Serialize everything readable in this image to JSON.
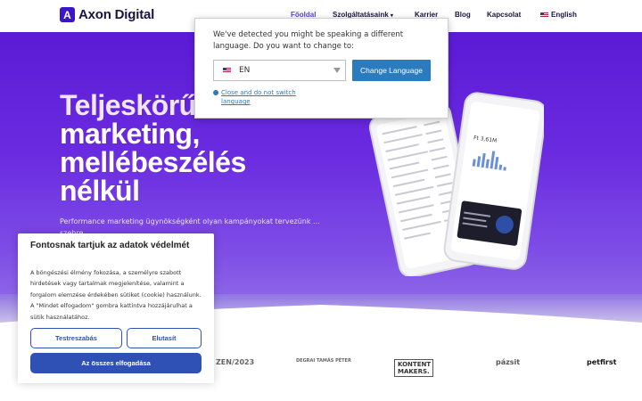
{
  "brand": {
    "name": "Axon Digital",
    "mark": "A"
  },
  "nav": {
    "items": [
      "Főoldal",
      "Szolgáltatásaink",
      "Karrier",
      "Blog",
      "Kapcsolat",
      "English"
    ]
  },
  "hero": {
    "headline": [
      "Teljeskörű",
      "marketing,",
      "mellébeszélés",
      "nélkül"
    ],
    "subtext": "Performance marketing ügynökségként olyan kampányokat tervezünk ... szebre."
  },
  "language_popup": {
    "message": "We've detected you might be speaking a different language. Do you want to change to:",
    "selected_language": "EN",
    "change_button": "Change Language",
    "close_link": "Close and do not switch language"
  },
  "cookie_banner": {
    "title": "Fontosnak tartjuk az adatok védelmét",
    "text": "A böngészési élmény fokozása, a személyre szabott hirdetések vagy tartalmak megjelenítése, valamint a forgalom elemzése érdekében sütiket (cookie) használunk. A \"Mindet elfogadom\" gombra kattintva hozzájárulhat a sütik használatához.",
    "customize_button": "Testreszabás",
    "reject_button": "Elutasít",
    "accept_all_button": "Az összes elfogadása"
  },
  "client_logos": [
    "ZEN/2023",
    "DEGRAI TAMÁS PÉTER",
    "KONTENT MAKERS.",
    "pázsit",
    "petfirst"
  ],
  "phone_mock": {
    "value": "Ft 3,61M"
  },
  "colors": {
    "hero_purple": "#5b1bd6",
    "button_blue": "#2f51b5",
    "link_blue": "#2b7bbf"
  }
}
